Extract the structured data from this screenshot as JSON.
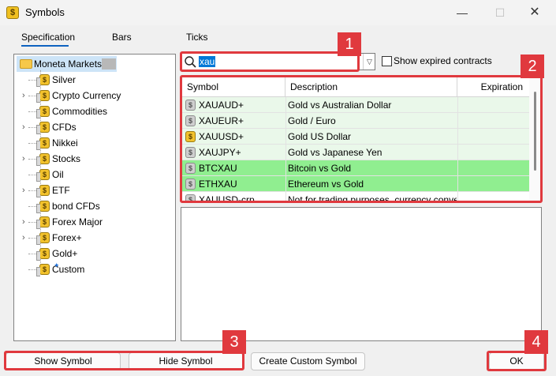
{
  "window": {
    "title": "Symbols",
    "minimize": "—",
    "maximize": "☐",
    "close": "✕"
  },
  "tabs": [
    "Specification",
    "Bars",
    "Ticks"
  ],
  "tree": {
    "root": "Moneta Markets",
    "items": [
      "Silver",
      "Crypto Currency",
      "Commodities",
      "CFDs",
      "Nikkei",
      "Stocks",
      "Oil",
      "ETF",
      "bond CFDs",
      "Forex Major",
      "Forex+",
      "Gold+",
      "Custom"
    ]
  },
  "search": {
    "value": "xau"
  },
  "expired_label": "Show expired contracts",
  "table": {
    "headers": [
      "Symbol",
      "Description",
      "Expiration"
    ],
    "rows": [
      {
        "symbol": "XAUAUD+",
        "description": "Gold vs Australian Dollar",
        "active": false,
        "highlight": "light"
      },
      {
        "symbol": "XAUEUR+",
        "description": "Gold / Euro",
        "active": false,
        "highlight": "light"
      },
      {
        "symbol": "XAUUSD+",
        "description": "Gold US Dollar",
        "active": true,
        "highlight": "light"
      },
      {
        "symbol": "XAUJPY+",
        "description": "Gold vs Japanese Yen",
        "active": false,
        "highlight": "light"
      },
      {
        "symbol": "BTCXAU",
        "description": "Bitcoin vs Gold",
        "active": false,
        "highlight": "strong"
      },
      {
        "symbol": "ETHXAU",
        "description": "Ethereum vs Gold",
        "active": false,
        "highlight": "strong"
      },
      {
        "symbol": "XAUUSD-crp",
        "description": "Not for trading purposes, currency conve",
        "active": false,
        "highlight": "none"
      }
    ]
  },
  "buttons": {
    "show": "Show Symbol",
    "hide": "Hide Symbol",
    "custom": "Create Custom Symbol",
    "ok": "OK"
  },
  "callouts": [
    "1",
    "2",
    "3",
    "4"
  ],
  "colors": {
    "highlight_light": "#eaf8ea",
    "highlight_strong": "#90ee90",
    "callout": "#e0393e",
    "accent": "#0f63c0"
  }
}
